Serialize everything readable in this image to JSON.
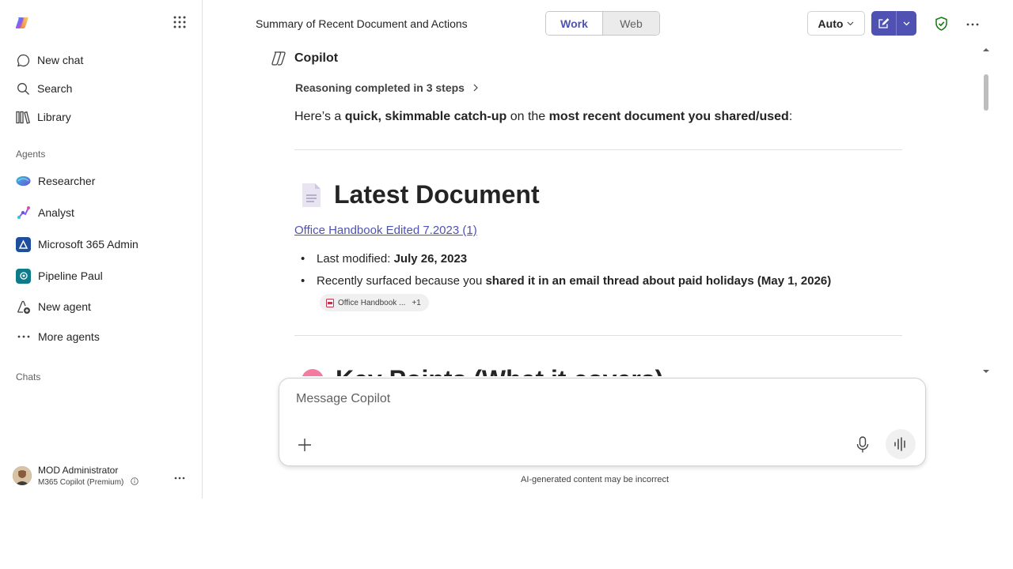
{
  "sidebar": {
    "nav": [
      {
        "label": "New chat",
        "icon": "chat-icon"
      },
      {
        "label": "Search",
        "icon": "search-icon"
      },
      {
        "label": "Library",
        "icon": "library-icon"
      }
    ],
    "agents_label": "Agents",
    "agents": [
      {
        "label": "Researcher",
        "icon": "researcher-icon"
      },
      {
        "label": "Analyst",
        "icon": "analyst-icon"
      },
      {
        "label": "Microsoft 365 Admin",
        "icon": "m365-admin-icon"
      },
      {
        "label": "Pipeline Paul",
        "icon": "pipeline-paul-icon"
      },
      {
        "label": "New agent",
        "icon": "new-agent-icon"
      },
      {
        "label": "More agents",
        "icon": "more-icon"
      }
    ],
    "chats_label": "Chats",
    "profile": {
      "name": "MOD Administrator",
      "subtitle": "M365 Copilot (Premium)"
    }
  },
  "header": {
    "title": "Summary of Recent Document and Actions",
    "mode_work": "Work",
    "mode_web": "Web",
    "selected_mode": "Work",
    "model": "Auto"
  },
  "content": {
    "sender": "Copilot",
    "reasoning": "Reasoning completed in 3 steps",
    "intro": {
      "p1": "Here’s a ",
      "b1": "quick, skimmable catch-up",
      "p2": " on the ",
      "b2": "most recent document you shared/used",
      "p3": ":"
    },
    "heading1": "Latest Document",
    "doc_link": "Office Handbook Edited 7.2023 (1)",
    "bullet1": {
      "prefix": "Last modified: ",
      "bold": "July 26, 2023"
    },
    "bullet2": {
      "prefix": "Recently surfaced because you ",
      "bold": "shared it in an email thread about paid holidays (May 1, 2026)"
    },
    "chip": {
      "label": "Office Handbook ...",
      "count": "+1"
    },
    "heading2_partial": "Key Points (What it covers)"
  },
  "composer": {
    "placeholder": "Message Copilot",
    "disclaimer": "AI-generated content may be incorrect"
  },
  "colors": {
    "accent": "#4f52b2",
    "shield": "#107c10"
  }
}
